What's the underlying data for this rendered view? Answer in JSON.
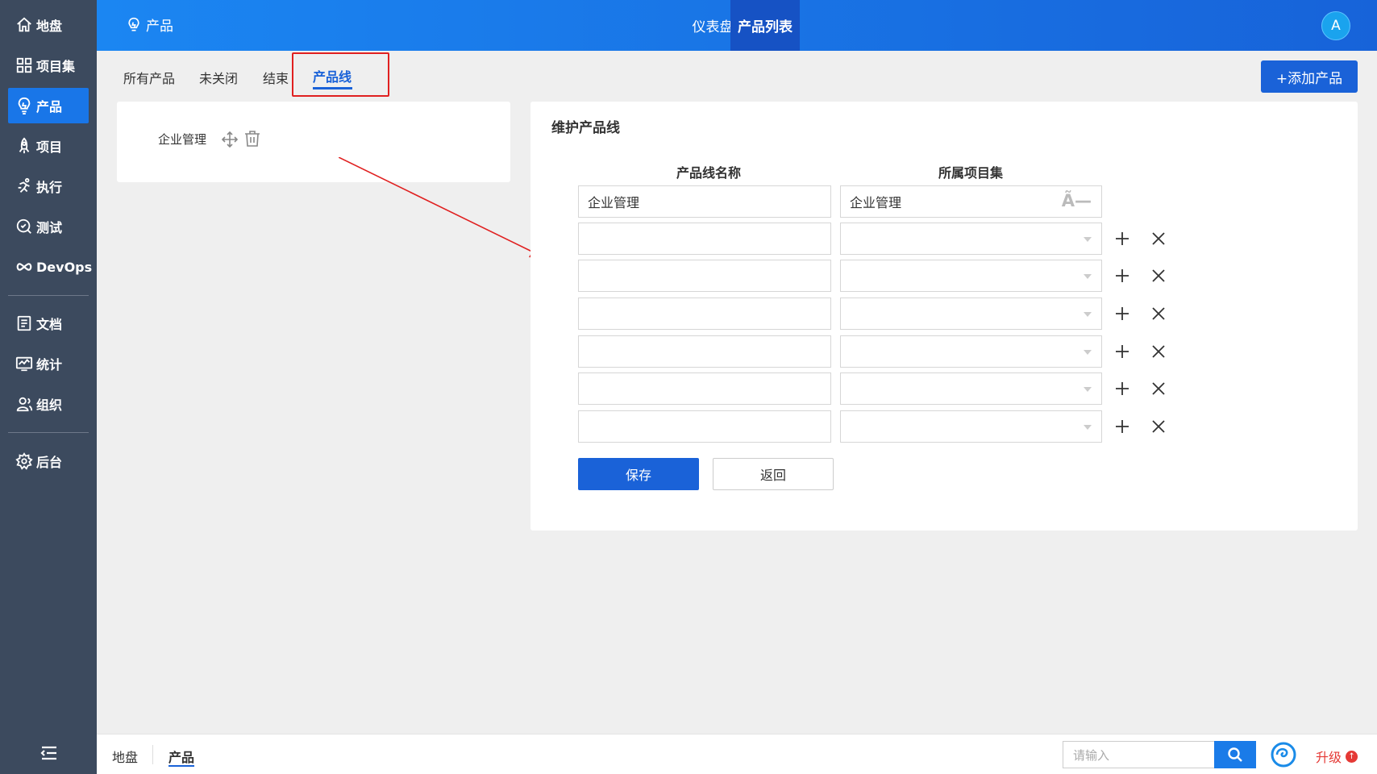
{
  "sidebar": {
    "items": [
      {
        "label": "地盘",
        "icon": "home-icon"
      },
      {
        "label": "项目集",
        "icon": "grid-icon"
      },
      {
        "label": "产品",
        "icon": "lightbulb-icon"
      },
      {
        "label": "项目",
        "icon": "rocket-icon"
      },
      {
        "label": "执行",
        "icon": "run-icon"
      },
      {
        "label": "测试",
        "icon": "test-icon"
      },
      {
        "label": "DevOps",
        "icon": "infinity-icon"
      },
      {
        "label": "文档",
        "icon": "document-icon"
      },
      {
        "label": "统计",
        "icon": "chart-monitor-icon"
      },
      {
        "label": "组织",
        "icon": "user-group-icon"
      },
      {
        "label": "后台",
        "icon": "gear-icon"
      }
    ],
    "active_index": 2
  },
  "header": {
    "breadcrumb": "产品",
    "nav": {
      "dashboard": "仪表盘",
      "product_list": "产品列表"
    },
    "avatar_letter": "A"
  },
  "tabs": {
    "all": "所有产品",
    "open": "未关闭",
    "closed": "结束",
    "product_line": "产品线"
  },
  "add_product_label": "+添加产品",
  "product_line_list": {
    "item": "企业管理"
  },
  "form": {
    "title": "维护产品线",
    "col_name": "产品线名称",
    "col_program": "所属项目集",
    "first_row": {
      "name": "企业管理",
      "program": "企业管理",
      "program_glyph": "Ã—"
    },
    "save_label": "保存",
    "back_label": "返回"
  },
  "bottom": {
    "home": "地盘",
    "product": "产品",
    "search_placeholder": "请输入",
    "upgrade": "升级",
    "upgrade_dot": "↑"
  },
  "colors": {
    "accent": "#1a62d8",
    "sidebar": "#3c4a5e",
    "highlight": "#e02020"
  }
}
